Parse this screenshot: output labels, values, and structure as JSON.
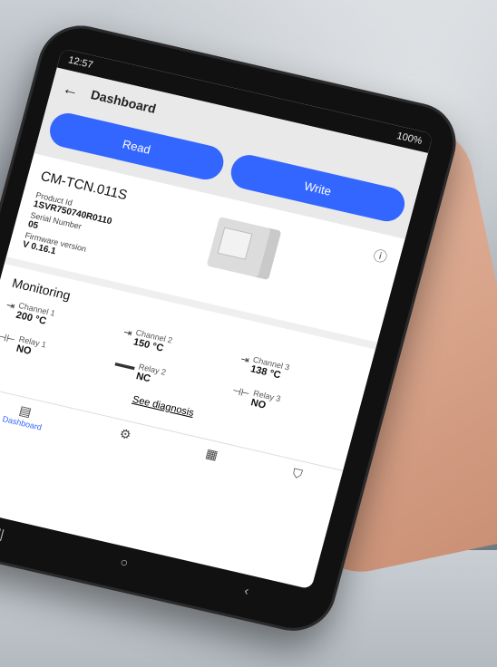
{
  "status": {
    "time": "12:57",
    "battery": "100%"
  },
  "appbar": {
    "back_icon": "arrow-left-icon",
    "title": "Dashboard"
  },
  "actions": {
    "read_label": "Read",
    "write_label": "Write"
  },
  "product": {
    "name": "CM-TCN.011S",
    "product_id_label": "Product Id",
    "product_id": "1SVR750740R0110",
    "serial_label": "Serial Number",
    "serial": "05",
    "firmware_label": "Firmware version",
    "firmware": "V 0.16.1",
    "info_icon": "info-circle-icon"
  },
  "monitoring": {
    "title": "Monitoring",
    "items": [
      {
        "label": "Channel 1",
        "value": "200 °C",
        "icon": "channel-icon"
      },
      {
        "label": "Channel 2",
        "value": "150 °C",
        "icon": "channel-icon"
      },
      {
        "label": "Channel 3",
        "value": "138 °C",
        "icon": "channel-icon"
      },
      {
        "label": "Relay 1",
        "value": "NO",
        "icon": "relay-icon"
      },
      {
        "label": "Relay 2",
        "value": "NC",
        "icon": "relay-icon"
      },
      {
        "label": "Relay 3",
        "value": "NO",
        "icon": "relay-icon"
      }
    ],
    "diagnosis_link": "See diagnosis"
  },
  "tabs": {
    "dashboard_label": "Dashboard",
    "icons": [
      "dashboard-icon",
      "gear-icon",
      "device-icon",
      "shield-check-icon"
    ]
  },
  "system_nav": {
    "icons": [
      "recents-icon",
      "home-icon",
      "back-icon"
    ]
  },
  "colors": {
    "accent": "#3366ff",
    "appbar": "#e9e9ea"
  }
}
